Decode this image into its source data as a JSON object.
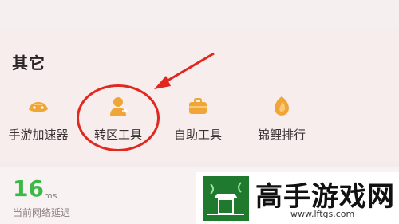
{
  "section": {
    "title": "其它"
  },
  "tools": [
    {
      "label": "手游加速器",
      "icon": "game-accelerator-icon"
    },
    {
      "label": "转区工具",
      "icon": "transfer-region-icon"
    },
    {
      "label": "自助工具",
      "icon": "self-service-toolbox-icon"
    },
    {
      "label": "锦鲤排行",
      "icon": "koi-ranking-icon"
    }
  ],
  "latency": {
    "value": "16",
    "unit": "ms",
    "label": "当前网络延迟"
  },
  "watermark": {
    "text": "高手游戏网",
    "url": "www.lftgs.com"
  },
  "colors": {
    "accent": "#f0a637",
    "highlight": "#e1281f",
    "latency": "#3cb846"
  }
}
